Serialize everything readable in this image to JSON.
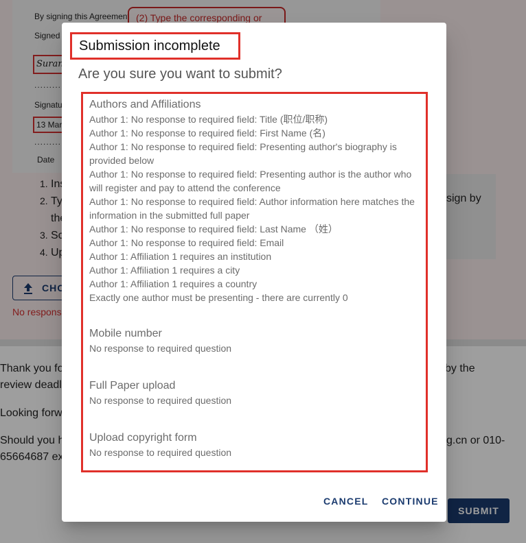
{
  "background": {
    "doc": {
      "line1": "By signing this Agreement",
      "line2": "Signed",
      "signature_text": "Suran",
      "line3": "Signatu",
      "date_text": "13 Marc",
      "line4": "Date",
      "dots": "............",
      "red_note": "(2) Type the corresponding or"
    },
    "steps": [
      {
        "num": "1.",
        "text": "Ins"
      },
      {
        "num": "2.",
        "text": "Ty"
      },
      {
        "num": "",
        "text": "the"
      },
      {
        "num": "3.",
        "text": "Sc"
      },
      {
        "num": "4.",
        "text": "Up"
      }
    ],
    "right_text": "sign by",
    "choose_button": "CHO",
    "no_response_red": "No respons",
    "para1a": "Thank you fo",
    "para1b": "review deadl",
    "para1_right": "by the",
    "para2": "Looking forw",
    "para3a": "Should you h",
    "para3b": "65664687 ex",
    "para3_right": "g.cn or 010-",
    "submit_label": "SUBMIT"
  },
  "dialog": {
    "title": "Submission incomplete",
    "subtitle": "Are you sure you want to submit?",
    "sections": [
      {
        "heading": "Authors and Affiliations",
        "issues": [
          "Author 1: No response to required field: Title (职位/职称)",
          "Author 1: No response to required field: First Name (名)",
          "Author 1: No response to required field: Presenting author's biography is provided below",
          "Author 1: No response to required field: Presenting author is the author who will register and pay to attend the conference",
          "Author 1: No response to required field: Author information here matches the information in the submitted full paper",
          "Author 1: No response to required field: Last Name （姓）",
          "Author 1: No response to required field: Email",
          "Author 1: Affiliation 1 requires an institution",
          "Author 1: Affiliation 1 requires a city",
          "Author 1: Affiliation 1 requires a country",
          "Exactly one author must be presenting - there are currently 0"
        ]
      },
      {
        "heading": "Mobile number",
        "issues": [
          "No response to required question"
        ]
      },
      {
        "heading": "Full Paper upload",
        "issues": [
          "No response to required question"
        ]
      },
      {
        "heading": "Upload copyright form",
        "issues": [
          "No response to required question"
        ]
      }
    ],
    "cancel_label": "CANCEL",
    "continue_label": "CONTINUE"
  },
  "colors": {
    "accent": "#1b3b6f",
    "highlight_red": "#e0302a"
  }
}
